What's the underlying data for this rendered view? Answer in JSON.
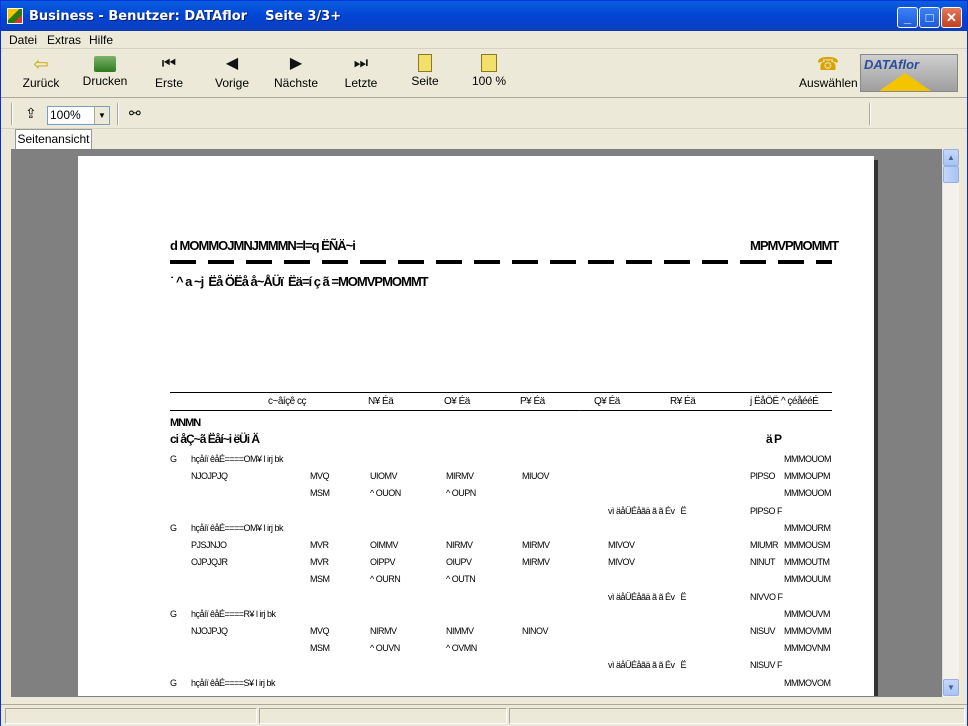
{
  "window": {
    "title": "Business - Benutzer: DATAflor    Seite 3/3+"
  },
  "menu": [
    "Datei",
    "Extras",
    "Hilfe"
  ],
  "toolbar": {
    "back": "Zurück",
    "print": "Drucken",
    "first": "Erste",
    "prev": "Vorige",
    "next": "Nächste",
    "last": "Letzte",
    "page": "Seite",
    "zoom": "100 %",
    "select": "Auswählen",
    "logo": "DATAflor"
  },
  "zoom_select": {
    "value": "100%"
  },
  "tab": {
    "label": "Seitenansicht"
  },
  "report": {
    "title_left": "d MOMMOJMNJMMMN=l=q ËÑÄ~i",
    "title_right": "MPMVPMOMMT",
    "subtitle": "˙ ^ a ~j  Ëå ÖËå å~ÅÜï  Ëä=í ç ã =MOMVPMOMMT",
    "columns": [
      "c~âíçê cç",
      "N¥ Éä",
      "O¥ Éä",
      "P¥ Éä",
      "Q¥ Éä",
      "R¥ Éä",
      "j ËåÖË ^ çéåééÉ"
    ],
    "group_code": "MNMN",
    "group_label": "ci åÇ~ã Ëåí~i ëÜi Ä",
    "group_unit": "ä P",
    "rows": [
      {
        "c0": "G",
        "c1": "hçåíï êåÉ====OM¥ l irj bk",
        "c8": "MMMOUOM"
      },
      {
        "c1": "NJOJPJQ",
        "c2": "MVQ",
        "c3": "UIOMV",
        "c4": "MIRMV",
        "c5": "MIUOV",
        "c7": "PIPSO",
        "c8": "MMMOUPM"
      },
      {
        "c2": "MSM",
        "c3": "^ OUON",
        "c4": "^ OUPN",
        "c8": "MMMOUOM"
      },
      {
        "c6": "vì äåÜÉåãä ã ã Év   Ë",
        "c7": "PIPSO F"
      },
      {
        "c0": "G",
        "c1": "hçåíï êåÉ====OM¥ l irj bk",
        "c8": "MMMOURM"
      },
      {
        "c1": "PJSJNJO",
        "c2": "MVR",
        "c3": "OIMMV",
        "c4": "NIRMV",
        "c5": "MIRMV",
        "c6": "MIVOV",
        "c7": "MIUMR",
        "c8": "MMMOUSM"
      },
      {
        "c1": "OJPJQJR",
        "c2": "MVR",
        "c3": "OIPPV",
        "c4": "OIUPV",
        "c5": "MIRMV",
        "c6": "MIVOV",
        "c7": "NINUT",
        "c8": "MMMOUTM"
      },
      {
        "c2": "MSM",
        "c3": "^ OURN",
        "c4": "^ OUTN",
        "c8": "MMMOUUM"
      },
      {
        "c6": "vì äåÜÉåãä ã ã Év   Ë",
        "c7": "NIVVO F"
      },
      {
        "c0": "G",
        "c1": "hçåíï êåÉ====R¥ l irj bk",
        "c8": "MMMOUVM"
      },
      {
        "c1": "NJOJPJQ",
        "c2": "MVQ",
        "c3": "NIRMV",
        "c4": "NIMMV",
        "c5": "NINOV",
        "c7": "NISUV",
        "c8": "MMMOVMM"
      },
      {
        "c2": "MSM",
        "c3": "^ OUVN",
        "c4": "^ OVMN",
        "c8": "MMMOVNM"
      },
      {
        "c6": "vì äåÜÉåãä ã ã Év   Ë",
        "c7": "NISUV F"
      },
      {
        "c0": "G",
        "c1": "hçåíï êåÉ====S¥ l irj bk",
        "c8": "MMMOVOM"
      }
    ]
  },
  "icons": {
    "back": "back-arrow-icon",
    "print": "printer-icon",
    "first": "first-page-icon",
    "prev": "previous-page-icon",
    "next": "next-page-icon",
    "last": "last-page-icon",
    "page": "page-icon",
    "zoom": "zoom-page-icon",
    "select": "select-icon",
    "export": "export-icon",
    "find": "binoculars-icon"
  }
}
